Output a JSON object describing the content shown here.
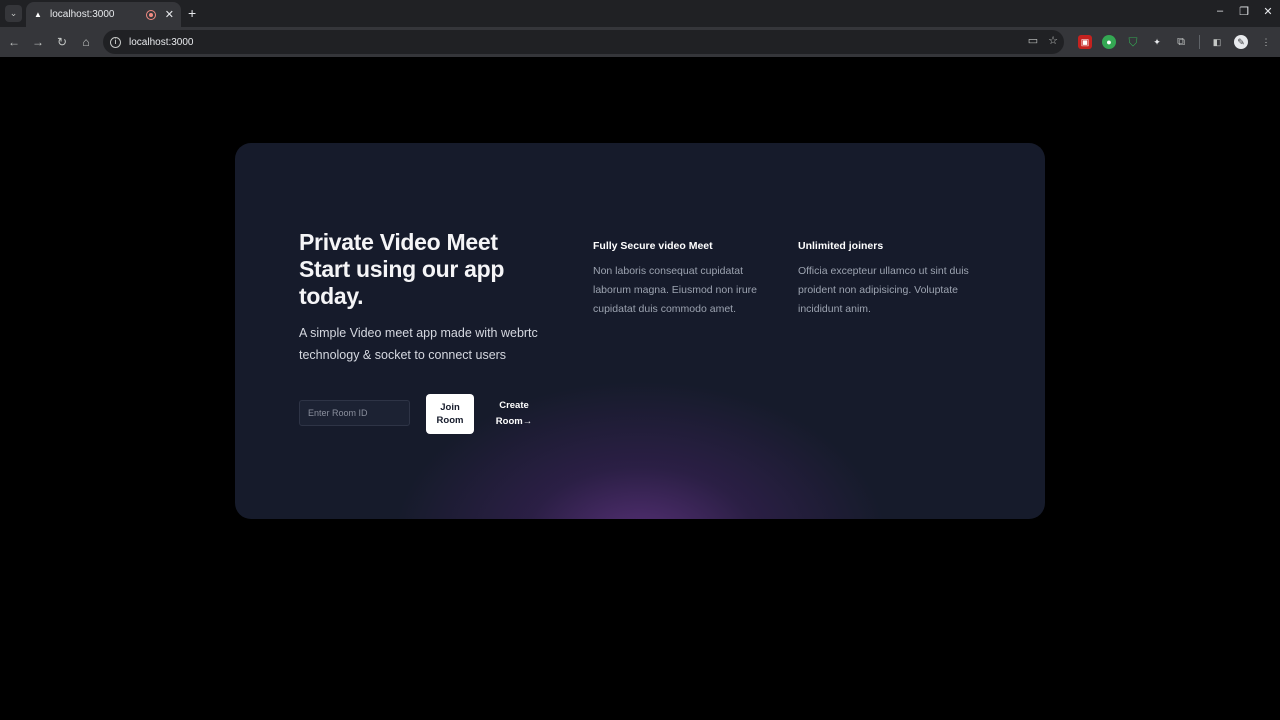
{
  "browser": {
    "tab_title": "localhost:3000",
    "url": "localhost:3000",
    "new_tab_symbol": "+",
    "close_tab_symbol": "✕"
  },
  "icons": {
    "back": "arrow-left-icon",
    "forward": "arrow-right-icon",
    "reload": "reload-icon",
    "home": "home-icon",
    "site_info": "info-icon",
    "camera": "video-camera-icon",
    "bookmark": "star-icon"
  },
  "hero": {
    "title": "Private Video Meet Start using our app today.",
    "description": "A simple Video meet app made with webrtc technology & socket to connect users",
    "room_input_placeholder": "Enter Room ID",
    "join_button": "Join Room",
    "create_button": "Create Room→"
  },
  "features": [
    {
      "title": "Fully Secure video Meet",
      "description": "Non laboris consequat cupidatat laborum magna. Eiusmod non irure cupidatat duis commodo amet."
    },
    {
      "title": "Unlimited joiners",
      "description": "Officia excepteur ullamco ut sint duis proident non adipisicing. Voluptate incididunt anim."
    }
  ],
  "colors": {
    "page_background": "#000000",
    "card_background": "#161b2b",
    "glow": "#623484",
    "button_background": "#ffffff"
  }
}
